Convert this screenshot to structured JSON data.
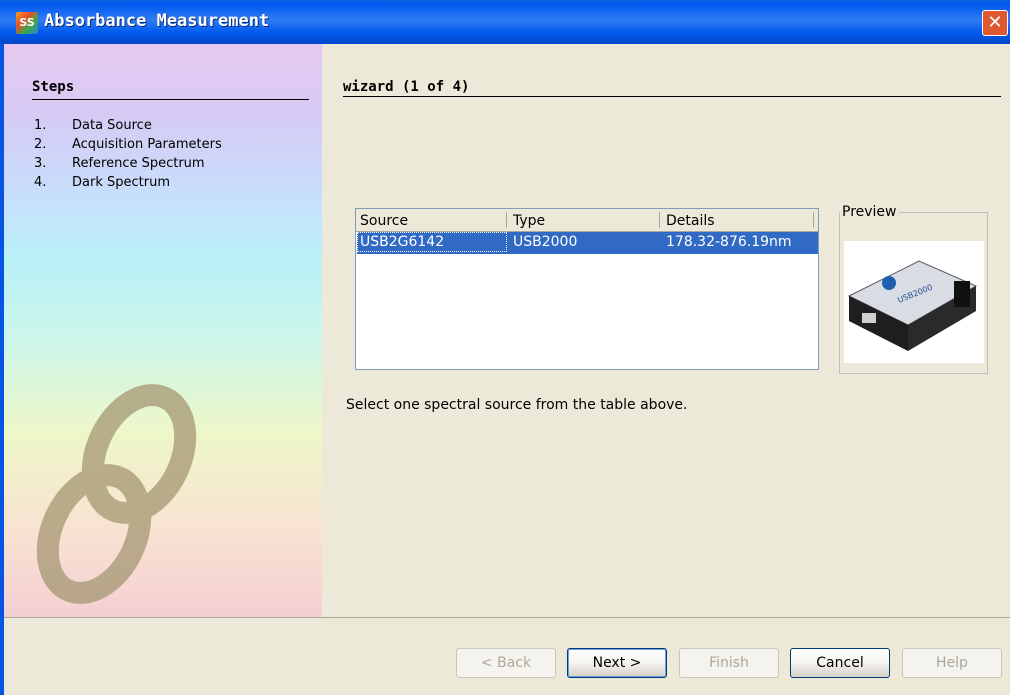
{
  "window": {
    "title": "Absorbance Measurement",
    "app_icon": "SS",
    "close_glyph": "✕"
  },
  "steps": {
    "heading": "Steps",
    "items": [
      {
        "num": "1.",
        "label": "Data Source"
      },
      {
        "num": "2.",
        "label": "Acquisition Parameters"
      },
      {
        "num": "3.",
        "label": "Reference Spectrum"
      },
      {
        "num": "4.",
        "label": "Dark Spectrum"
      }
    ]
  },
  "wizard": {
    "title": "wizard (1 of 4)",
    "table": {
      "columns": [
        "Source",
        "Type",
        "Details"
      ],
      "rows": [
        {
          "source": "USB2G6142",
          "type": "USB2000",
          "details": "178.32-876.19nm"
        }
      ]
    },
    "preview_label": "Preview",
    "device_label": "USB2000",
    "hint": "Select one spectral source from the table above."
  },
  "buttons": {
    "back": "< Back",
    "next": "Next >",
    "finish": "Finish",
    "cancel": "Cancel",
    "help": "Help"
  },
  "colors": {
    "titlebar": "#0058ee",
    "selection": "#316ac5",
    "dialog_bg": "#ece9d8"
  }
}
